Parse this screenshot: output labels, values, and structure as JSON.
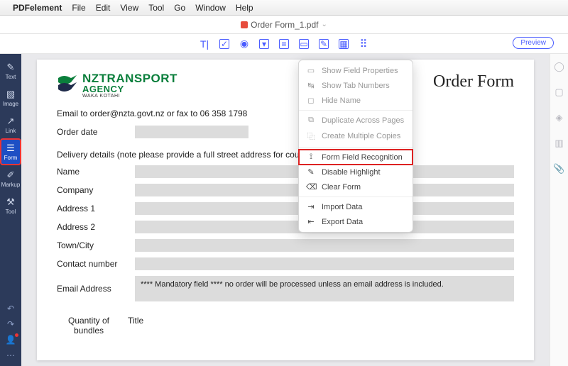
{
  "menubar": {
    "app": "PDFelement",
    "items": [
      "File",
      "Edit",
      "View",
      "Tool",
      "Go",
      "Window",
      "Help"
    ]
  },
  "titlebar": {
    "doc_name": "Order Form_1.pdf"
  },
  "toolbar": {
    "preview": "Preview"
  },
  "sidebar_left": {
    "items": [
      {
        "label": "Text"
      },
      {
        "label": "Image"
      },
      {
        "label": "Link"
      },
      {
        "label": "Form"
      },
      {
        "label": "Markup"
      },
      {
        "label": "Tool"
      }
    ]
  },
  "document": {
    "logo": {
      "line1": "NZTRANSPORT",
      "line2": "AGENCY",
      "line3": "WAKA KOTAHI"
    },
    "heading": "Order Form",
    "email_line": "Email to order@nzta.govt.nz or fax to 06 358 1798",
    "order_date_label": "Order date",
    "delivery_heading": "Delivery details (note please provide a full street address for courier delivery)",
    "fields": {
      "name": "Name",
      "company": "Company",
      "address1": "Address 1",
      "address2": "Address 2",
      "town": "Town/City",
      "contact": "Contact number",
      "email": "Email Address"
    },
    "mandatory_note": "**** Mandatory field **** no order will be processed unless an email address is included.",
    "cols": {
      "qty": "Quantity of bundles",
      "title": "Title"
    }
  },
  "dropdown": {
    "items": [
      {
        "label": "Show Field Properties",
        "enabled": false
      },
      {
        "label": "Show Tab Numbers",
        "enabled": false
      },
      {
        "label": "Hide Name",
        "enabled": false
      },
      {
        "label": "Duplicate Across Pages",
        "enabled": false
      },
      {
        "label": "Create Multiple Copies",
        "enabled": false
      },
      {
        "label": "Form Field Recognition",
        "enabled": true,
        "highlight": true
      },
      {
        "label": "Disable Highlight",
        "enabled": true
      },
      {
        "label": "Clear Form",
        "enabled": true
      },
      {
        "label": "Import Data",
        "enabled": true
      },
      {
        "label": "Export Data",
        "enabled": true
      }
    ]
  }
}
